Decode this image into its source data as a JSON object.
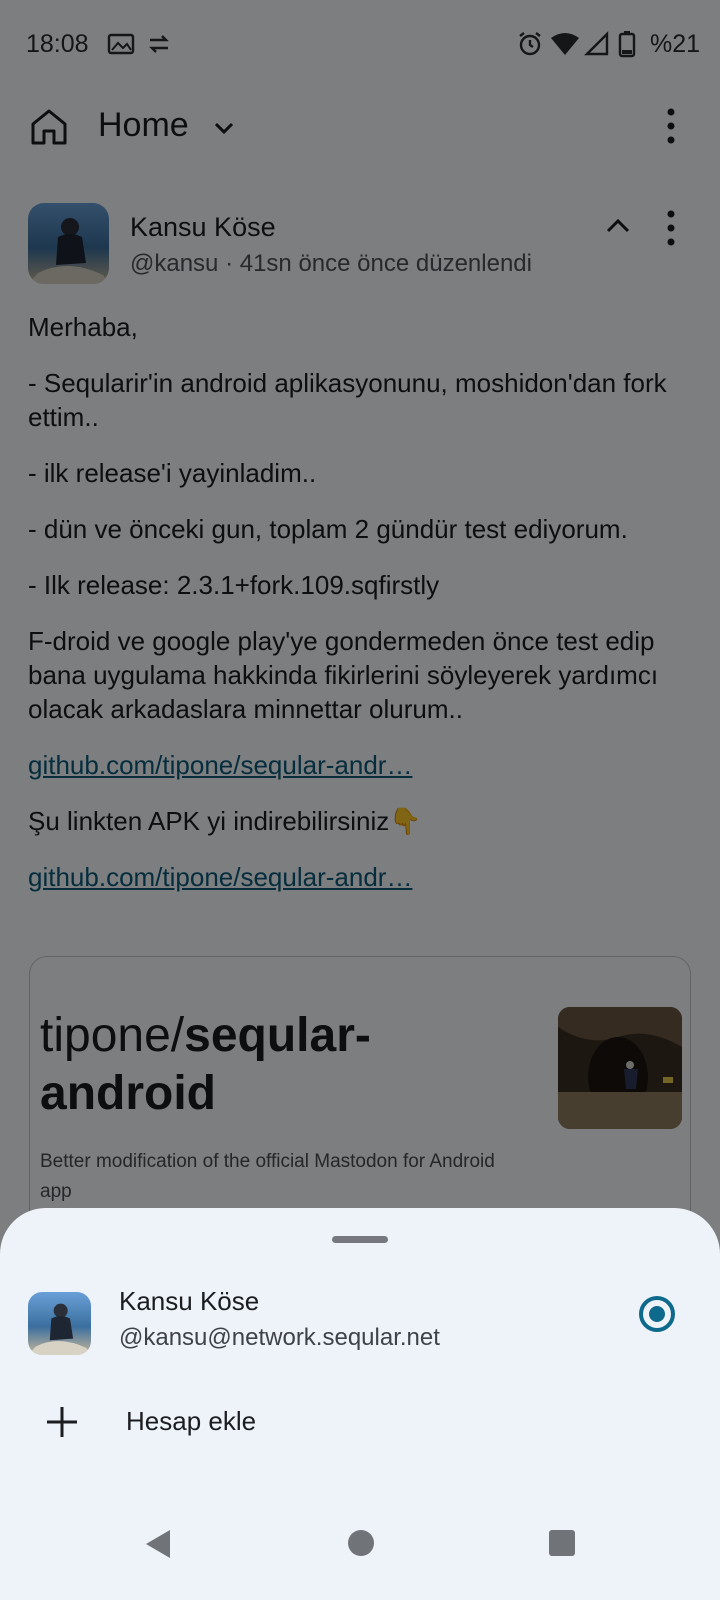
{
  "status": {
    "time": "18:08",
    "battery": "%21"
  },
  "appbar": {
    "title": "Home"
  },
  "post": {
    "author_name": "Kansu Köse",
    "meta": "@kansu · 41sn önce önce düzenlendi",
    "paragraphs": [
      "Merhaba,",
      "- Seqularir'in android aplikasyonunu, moshidon'dan fork ettim..",
      "- ilk release'i yayinladim..",
      "- dün ve önceki gun, toplam 2 gündür test ediyorum.",
      "- Ilk release: 2.3.1+fork.109.sqfirstly",
      "F-droid ve google play'ye gondermeden önce test edip bana uygulama hakkinda fikirlerini söyleyerek yardımcı olacak arkadaslara minnettar olurum.."
    ],
    "link1": "github.com/tipone/seqular-andr…",
    "apk_text": "Şu linkten APK yi indirebilirsiniz👇",
    "link2": "github.com/tipone/seqular-andr…"
  },
  "card": {
    "title_prefix": "tipone/",
    "title_bold": "seqular-android",
    "description": "Better modification of the official Mastodon for Android app"
  },
  "sheet": {
    "account_name": "Kansu Köse",
    "account_handle": "@kansu@network.seqular.net",
    "add_account_label": "Hesap ekle"
  },
  "colors": {
    "accent": "#0e6a8c",
    "sheet_bg": "#eef3fa",
    "link": "#0b5a7a"
  },
  "icons": [
    "image-icon",
    "sync-icon",
    "alarm-icon",
    "wifi-icon",
    "signal-icon",
    "battery-icon",
    "home-icon",
    "chevron-down-icon",
    "more-vert-icon",
    "chevron-up-icon",
    "plus-icon",
    "nav-back-icon",
    "nav-home-icon",
    "nav-recents-icon"
  ]
}
